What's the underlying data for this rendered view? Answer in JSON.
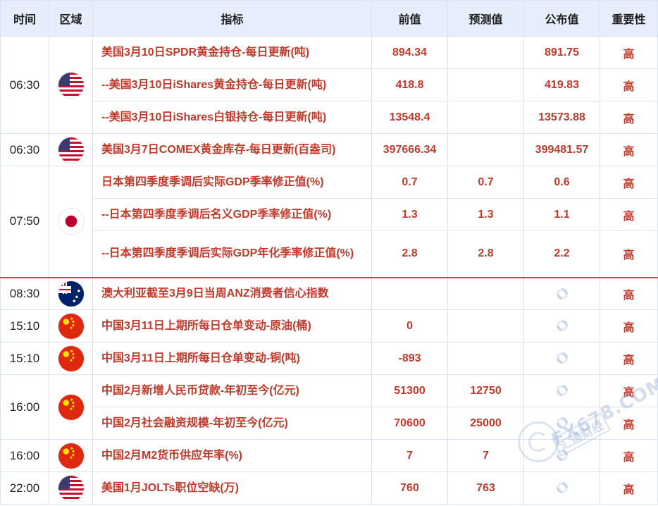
{
  "headers": {
    "time": "时间",
    "region": "区域",
    "indicator": "指标",
    "previous": "前值",
    "forecast": "预测值",
    "actual": "公布值",
    "importance": "重要性"
  },
  "groups": [
    {
      "time": "06:30",
      "flag": "us-flag-icon",
      "rows": [
        {
          "indicator": "美国3月10日SPDR黄金持仓-每日更新(吨)",
          "previous": "894.34",
          "forecast": "",
          "actual": "891.75",
          "importance": "高"
        },
        {
          "indicator": "--美国3月10日iShares黄金持仓-每日更新(吨)",
          "previous": "418.8",
          "forecast": "",
          "actual": "419.83",
          "importance": "高"
        },
        {
          "indicator": "--美国3月10日iShares白银持仓-每日更新(吨)",
          "previous": "13548.4",
          "forecast": "",
          "actual": "13573.88",
          "importance": "高"
        }
      ]
    },
    {
      "time": "06:30",
      "flag": "us-flag-icon",
      "rows": [
        {
          "indicator": "美国3月7日COMEX黄金库存-每日更新(百盎司)",
          "previous": "397666.34",
          "forecast": "",
          "actual": "399481.57",
          "importance": "高"
        }
      ]
    },
    {
      "time": "07:50",
      "flag": "japan-flag-icon",
      "rows": [
        {
          "indicator": "日本第四季度季调后实际GDP季率修正值(%)",
          "previous": "0.7",
          "forecast": "0.7",
          "actual": "0.6",
          "importance": "高"
        },
        {
          "indicator": "--日本第四季度季调后名义GDP季率修正值(%)",
          "previous": "1.3",
          "forecast": "1.3",
          "actual": "1.1",
          "importance": "高"
        },
        {
          "indicator": "--日本第四季度季调后实际GDP年化季率修正值(%)",
          "previous": "2.8",
          "forecast": "2.8",
          "actual": "2.2",
          "importance": "高"
        }
      ]
    },
    {
      "time": "08:30",
      "flag": "australia-flag-icon",
      "rows": [
        {
          "indicator": "澳大利亚截至3月9日当周ANZ消费者信心指数",
          "previous": "",
          "forecast": "",
          "actual": "",
          "pending": true,
          "importance": "高"
        }
      ]
    },
    {
      "time": "15:10",
      "flag": "china-flag-icon",
      "rows": [
        {
          "indicator": "中国3月11日上期所每日仓单变动-原油(桶)",
          "previous": "0",
          "forecast": "",
          "actual": "",
          "pending": true,
          "importance": "高"
        }
      ]
    },
    {
      "time": "15:10",
      "flag": "china-flag-icon",
      "rows": [
        {
          "indicator": "中国3月11日上期所每日仓单变动-铜(吨)",
          "previous": "-893",
          "forecast": "",
          "actual": "",
          "pending": true,
          "importance": "高"
        }
      ]
    },
    {
      "time": "16:00",
      "flag": "china-flag-icon",
      "rows": [
        {
          "indicator": "中国2月新增人民币贷款-年初至今(亿元)",
          "previous": "51300",
          "forecast": "12750",
          "actual": "",
          "pending": true,
          "importance": "高"
        },
        {
          "indicator": "中国2月社会融资规模-年初至今(亿元)",
          "previous": "70600",
          "forecast": "25000",
          "actual": "",
          "pending": true,
          "importance": "高"
        }
      ]
    },
    {
      "time": "16:00",
      "flag": "china-flag-icon",
      "rows": [
        {
          "indicator": "中国2月M2货币供应年率(%)",
          "previous": "7",
          "forecast": "7",
          "actual": "",
          "pending": true,
          "importance": "高"
        }
      ]
    },
    {
      "time": "22:00",
      "flag": "us-flag-icon",
      "rows": [
        {
          "indicator": "美国1月JOLTs职位空缺(万)",
          "previous": "760",
          "forecast": "763",
          "actual": "",
          "pending": true,
          "importance": "高"
        }
      ]
    }
  ],
  "watermark": {
    "brand": "FX678.COM",
    "tagline": "汇通财经"
  },
  "colors": {
    "header_bg": "#e6eefc",
    "accent_red": "#c0392b",
    "grid": "#d9e3f2"
  }
}
